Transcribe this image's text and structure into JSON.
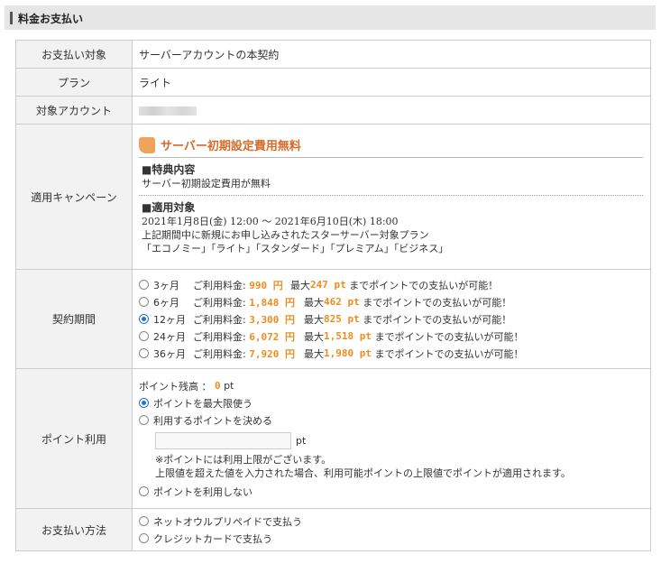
{
  "section_title": "料金お支払い",
  "rows": {
    "target": {
      "label": "お支払い対象",
      "value": "サーバーアカウントの本契約"
    },
    "plan": {
      "label": "プラン",
      "value": "ライト"
    },
    "account": {
      "label": "対象アカウント",
      "value": ""
    },
    "campaign": {
      "label": "適用キャンペーン",
      "title": "サーバー初期設定費用無料",
      "benefit_heading": "■特典内容",
      "benefit_text": "サーバー初期設定費用が無料",
      "target_heading": "■適用対象",
      "period": "2021年1月8日(金) 12:00 〜 2021年6月10日(木) 18:00",
      "condition": "上記期間中に新規にお申し込みされたスターサーバー対象プラン",
      "plans": "「エコノミー」「ライト」「スタンダード」「プレミアム」「ビジネス」"
    },
    "contract": {
      "label": "契約期間",
      "options": [
        {
          "months": "3ヶ月",
          "fee_label": "ご利用料金:",
          "fee": "990 円",
          "max_label": "最大",
          "points": "247 pt",
          "suffix": "までポイントでの支払いが可能！",
          "selected": false
        },
        {
          "months": "6ヶ月",
          "fee_label": "ご利用料金:",
          "fee": "1,848 円",
          "max_label": "最大",
          "points": "462 pt",
          "suffix": "までポイントでの支払いが可能！",
          "selected": false
        },
        {
          "months": "12ヶ月",
          "fee_label": "ご利用料金:",
          "fee": "3,300 円",
          "max_label": "最大",
          "points": "825 pt",
          "suffix": "までポイントでの支払いが可能！",
          "selected": true
        },
        {
          "months": "24ヶ月",
          "fee_label": "ご利用料金:",
          "fee": "6,072 円",
          "max_label": "最大",
          "points": "1,518 pt",
          "suffix": "までポイントでの支払いが可能！",
          "selected": false
        },
        {
          "months": "36ヶ月",
          "fee_label": "ご利用料金:",
          "fee": "7,920 円",
          "max_label": "最大",
          "points": "1,980 pt",
          "suffix": "までポイントでの支払いが可能！",
          "selected": false
        }
      ]
    },
    "points": {
      "label": "ポイント利用",
      "balance_label": "ポイント残高 ：",
      "balance_value": "0",
      "balance_unit": "pt",
      "opt_max": "ポイントを最大限使う",
      "opt_decide": "利用するポイントを決める",
      "input_value": "",
      "input_unit": "pt",
      "note1": "※ポイントには利用上限がございます。",
      "note2": "上限値を超えた値を入力された場合、利用可能ポイントの上限値でポイントが適用されます。",
      "opt_none": "ポイントを利用しない"
    },
    "payment": {
      "label": "お支払い方法",
      "opt_prepaid": "ネットオウルプリペイドで支払う",
      "opt_card": "クレジットカードで支払う"
    }
  }
}
